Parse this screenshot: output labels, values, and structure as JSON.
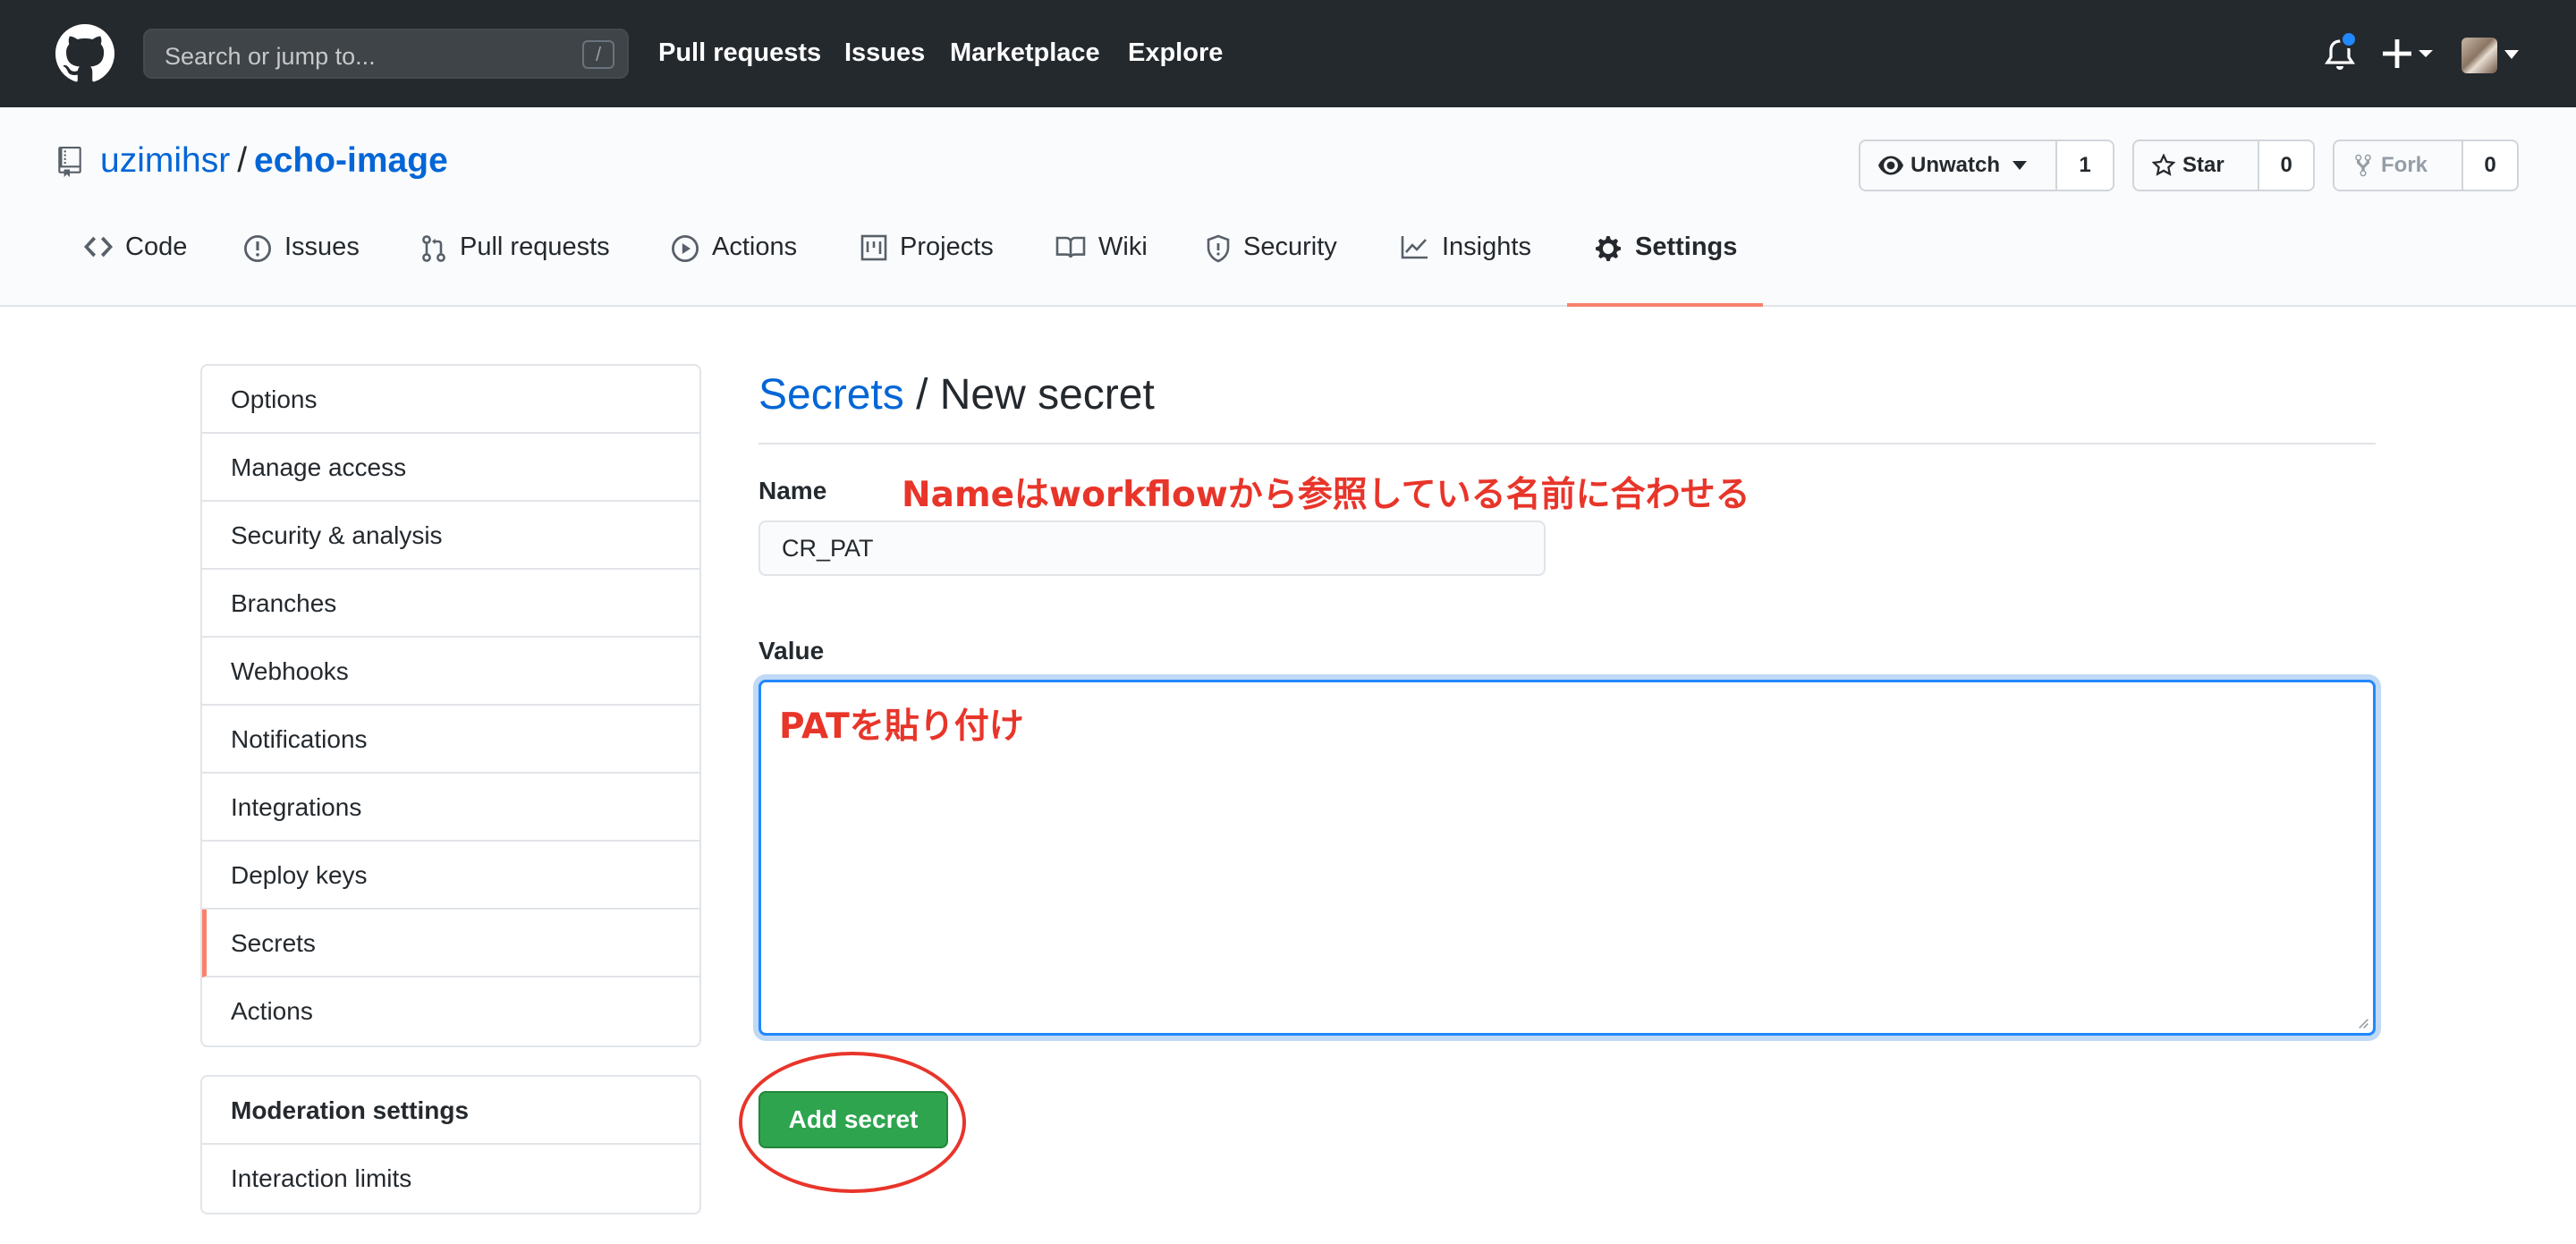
{
  "header": {
    "search_placeholder": "Search or jump to...",
    "search_shortcut": "/",
    "nav": [
      "Pull requests",
      "Issues",
      "Marketplace",
      "Explore"
    ],
    "plus_label": "+"
  },
  "repo": {
    "owner": "uzimihsr",
    "separator": "/",
    "name": "echo-image",
    "watch": {
      "label": "Unwatch",
      "count": "1"
    },
    "star": {
      "label": "Star",
      "count": "0"
    },
    "fork": {
      "label": "Fork",
      "count": "0"
    }
  },
  "tabs": [
    "Code",
    "Issues",
    "Pull requests",
    "Actions",
    "Projects",
    "Wiki",
    "Security",
    "Insights",
    "Settings"
  ],
  "sidebar": {
    "items": [
      "Options",
      "Manage access",
      "Security & analysis",
      "Branches",
      "Webhooks",
      "Notifications",
      "Integrations",
      "Deploy keys",
      "Secrets",
      "Actions"
    ],
    "active": "Secrets",
    "moderation_heading": "Moderation settings",
    "moderation_items": [
      "Interaction limits"
    ]
  },
  "main": {
    "breadcrumb_link": "Secrets",
    "breadcrumb_rest": " / New secret",
    "name_label": "Name",
    "name_value": "CR_PAT",
    "value_label": "Value",
    "submit_label": "Add secret"
  },
  "annotations": {
    "name_note": "Nameはworkflowから参照している名前に合わせる",
    "value_note": "PATを貼り付け",
    "color": "#e8352a"
  },
  "colors": {
    "header_bg": "#24292e",
    "link": "#0366d6",
    "active_tab_underline": "#f9826c",
    "primary_button": "#2ea44f",
    "focus_border": "#2188ff"
  }
}
